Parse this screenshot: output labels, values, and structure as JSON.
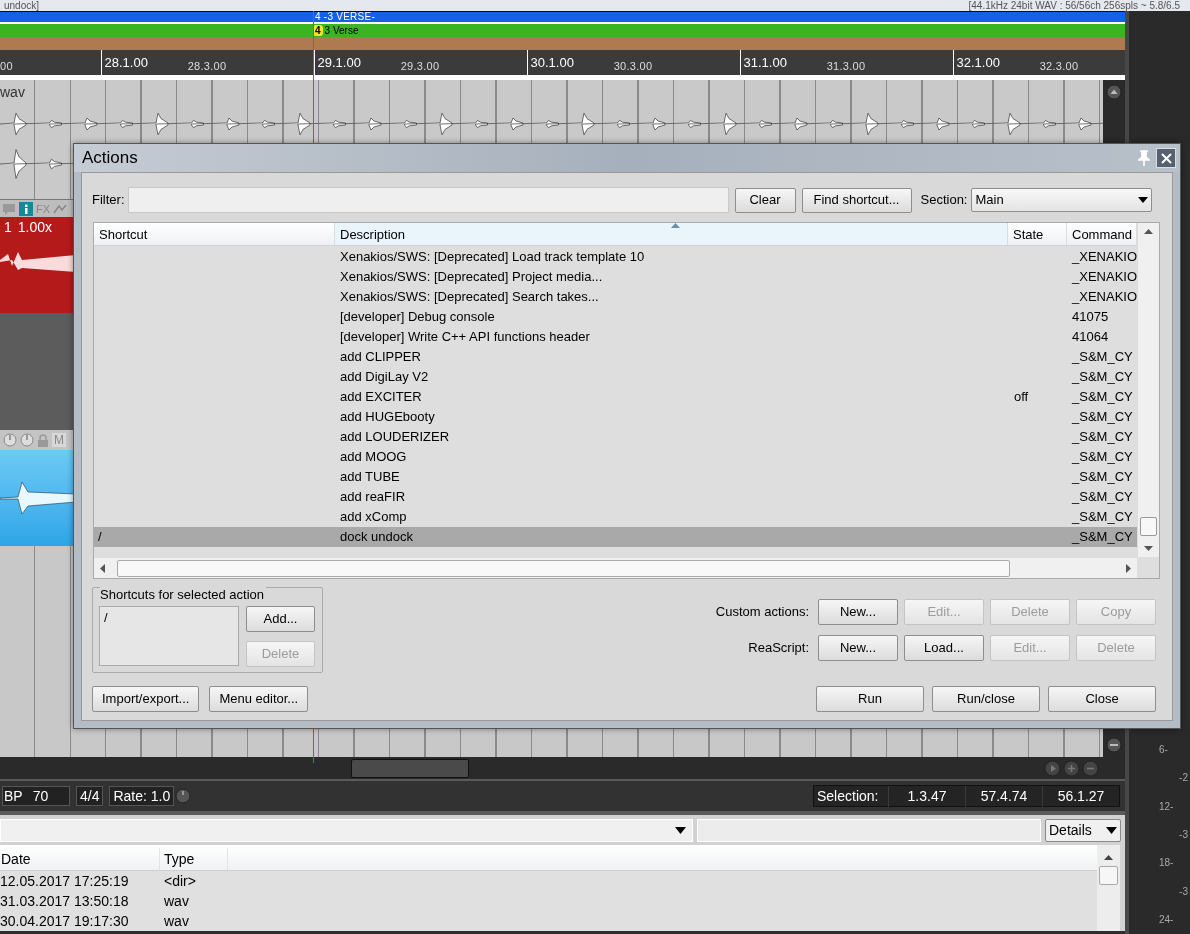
{
  "app_bar": {
    "left": "undock]",
    "right": "[44.1kHz 24bit WAV : 56/56ch 256spls ~ 5.8/6.5"
  },
  "region": {
    "label": "4 -3 VERSE-"
  },
  "marker": {
    "number": "4",
    "label": "3 Verse"
  },
  "ruler": [
    {
      "label": "00",
      "kind": "minor"
    },
    {
      "label": "28.1.00",
      "kind": "major"
    },
    {
      "label": "28.3.00",
      "kind": "minor"
    },
    {
      "label": "29.1.00",
      "kind": "major"
    },
    {
      "label": "29.3.00",
      "kind": "minor"
    },
    {
      "label": "30.1.00",
      "kind": "major"
    },
    {
      "label": "30.3.00",
      "kind": "minor"
    },
    {
      "label": "31.1.00",
      "kind": "major"
    },
    {
      "label": "31.3.00",
      "kind": "minor"
    },
    {
      "label": "32.1.00",
      "kind": "major"
    },
    {
      "label": "32.3.00",
      "kind": "minor"
    }
  ],
  "tracks": {
    "item_label": "wav",
    "fx_label": "FX",
    "item_number": "1",
    "item_rate": "1.00x",
    "mute_label": "M"
  },
  "transport": {
    "bpm_label": "BP",
    "bpm": "70",
    "signature": "4/4",
    "rate": "Rate: 1.0",
    "selection_label": "Selection:",
    "selection": [
      "1.3.47",
      "57.4.74",
      "56.1.27"
    ]
  },
  "media_explorer": {
    "view_button": "Details",
    "columns": [
      "Date",
      "Type"
    ],
    "rows": [
      [
        "12.05.2017 17:25:19",
        "<dir>"
      ],
      [
        "31.03.2017 13:50:18",
        "wav"
      ],
      [
        "30.04.2017 19:17:30",
        "wav"
      ]
    ]
  },
  "meter_labels": [
    "6-",
    "-2",
    "12-",
    "-3",
    "18-",
    "-3",
    "24-"
  ],
  "dialog": {
    "title": "Actions",
    "filter_label": "Filter:",
    "clear": "Clear",
    "find": "Find shortcut...",
    "section_label": "Section:",
    "section": "Main",
    "columns": [
      {
        "label": "Shortcut",
        "sorted": false
      },
      {
        "label": "Description",
        "sorted": true
      },
      {
        "label": "State",
        "sorted": false
      },
      {
        "label": "Command",
        "sorted": false
      }
    ],
    "rows": [
      {
        "description": "Xenakios/SWS: [Deprecated] Load track template 10",
        "command": "_XENAKIO",
        "selected": false
      },
      {
        "description": "Xenakios/SWS: [Deprecated] Project media...",
        "command": "_XENAKIO",
        "selected": false
      },
      {
        "description": "Xenakios/SWS: [Deprecated] Search takes...",
        "command": "_XENAKIO",
        "selected": false
      },
      {
        "description": "[developer] Debug console",
        "command": "41075",
        "selected": false
      },
      {
        "description": "[developer] Write C++ API functions header",
        "command": "41064",
        "selected": false
      },
      {
        "description": "add CLIPPER",
        "command": "_S&M_CY",
        "selected": false
      },
      {
        "description": "add DigiLay V2",
        "command": "_S&M_CY",
        "selected": false
      },
      {
        "description": "add EXCITER",
        "state": "off",
        "command": "_S&M_CY",
        "selected": false
      },
      {
        "description": "add HUGEbooty",
        "command": "_S&M_CY",
        "selected": false
      },
      {
        "description": "add LOUDERIZER",
        "command": "_S&M_CY",
        "selected": false
      },
      {
        "description": "add MOOG",
        "command": "_S&M_CY",
        "selected": false
      },
      {
        "description": "add TUBE",
        "command": "_S&M_CY",
        "selected": false
      },
      {
        "description": "add reaFIR",
        "command": "_S&M_CY",
        "selected": false
      },
      {
        "description": "add xComp",
        "command": "_S&M_CY",
        "selected": false
      },
      {
        "shortcut": "/",
        "description": "dock undock",
        "command": "_S&M_CY",
        "selected": true
      }
    ],
    "shortcuts_group": {
      "title": "Shortcuts for selected action",
      "items": [
        "/"
      ],
      "buttons": [
        {
          "label": "Add...",
          "disabled": false
        },
        {
          "label": "Delete",
          "disabled": true
        }
      ]
    },
    "custom_actions": {
      "label": "Custom actions:",
      "buttons": [
        {
          "label": "New...",
          "disabled": false
        },
        {
          "label": "Edit...",
          "disabled": true
        },
        {
          "label": "Delete",
          "disabled": true
        },
        {
          "label": "Copy",
          "disabled": true
        }
      ]
    },
    "reascript": {
      "label": "ReaScript:",
      "buttons": [
        {
          "label": "New...",
          "disabled": false
        },
        {
          "label": "Load...",
          "disabled": false
        },
        {
          "label": "Edit...",
          "disabled": true
        },
        {
          "label": "Delete",
          "disabled": true
        }
      ]
    },
    "footer_left": [
      {
        "label": "Import/export...",
        "disabled": false
      },
      {
        "label": "Menu editor...",
        "disabled": false
      }
    ],
    "footer_right": [
      {
        "label": "Run",
        "disabled": false
      },
      {
        "label": "Run/close",
        "disabled": false
      },
      {
        "label": "Close",
        "disabled": false
      }
    ]
  }
}
